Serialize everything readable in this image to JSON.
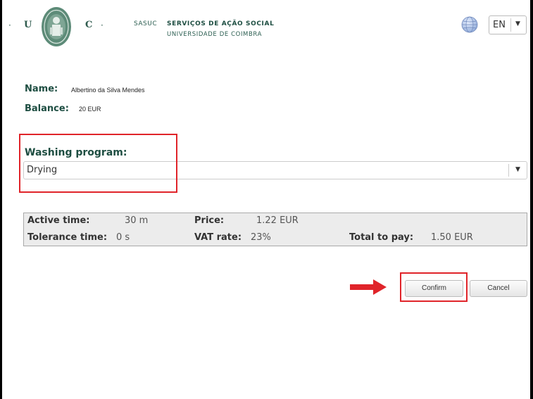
{
  "header": {
    "logo_letters": [
      "U",
      "C"
    ],
    "sasuc": "SASUC",
    "org_title": "SERVIÇOS DE AÇÃO SOCIAL",
    "org_subtitle": "UNIVERSIDADE DE COIMBRA",
    "language": "EN"
  },
  "user": {
    "name_label": "Name:",
    "name_value": "Albertino da Silva Mendes",
    "balance_label": "Balance:",
    "balance_value": "20 EUR"
  },
  "program": {
    "label": "Washing program:",
    "selected": "Drying"
  },
  "details": {
    "active_time_label": "Active time:",
    "active_time_value": "30 m",
    "price_label": "Price:",
    "price_value": "1.22 EUR",
    "tolerance_label": "Tolerance time:",
    "tolerance_value": "0 s",
    "vat_label": "VAT rate:",
    "vat_value": "23%",
    "total_label": "Total to pay:",
    "total_value": "1.50 EUR"
  },
  "buttons": {
    "confirm": "Confirm",
    "cancel": "Cancel"
  },
  "colors": {
    "brand": "#1e4e42",
    "highlight": "#e0242a"
  },
  "icons": [
    "university-seal",
    "globe-icon",
    "chevron-down-icon",
    "arrow-right-icon"
  ]
}
